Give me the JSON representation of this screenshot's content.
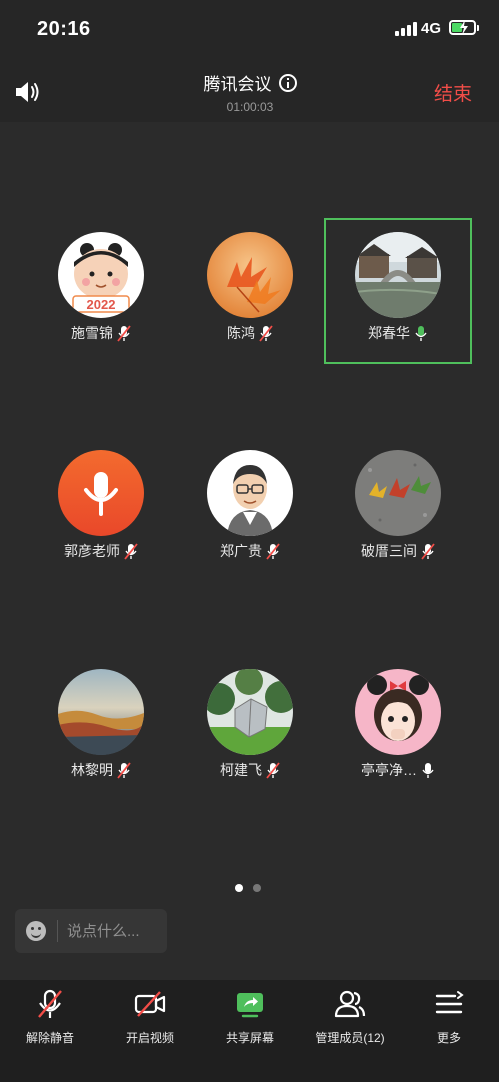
{
  "status_bar": {
    "time": "20:16",
    "network": "4G"
  },
  "header": {
    "title": "腾讯会议",
    "timer": "01:00:03",
    "end_label": "结束"
  },
  "participants": [
    {
      "name": "施雪锦",
      "mic": "muted",
      "avatar": "cartoon-girl-2022"
    },
    {
      "name": "陈鸿",
      "mic": "muted",
      "avatar": "maple-leaves"
    },
    {
      "name": "郑春华",
      "mic": "speaking",
      "avatar": "water-town-bridge"
    },
    {
      "name": "郭彦老师",
      "mic": "muted",
      "avatar": "orange-mic"
    },
    {
      "name": "郑广贵",
      "mic": "muted",
      "avatar": "cartoon-man-glasses"
    },
    {
      "name": "破厝三间",
      "mic": "muted",
      "avatar": "leaves-on-ground"
    },
    {
      "name": "林黎明",
      "mic": "muted",
      "avatar": "autumn-landscape"
    },
    {
      "name": "柯建飞",
      "mic": "muted",
      "avatar": "garden-sculpture"
    },
    {
      "name": "亭亭净…",
      "mic": "on",
      "avatar": "cartoon-girl-bow"
    }
  ],
  "pagination": {
    "total": 2,
    "current": 1
  },
  "chat": {
    "placeholder": "说点什么..."
  },
  "toolbar": {
    "unmute": "解除静音",
    "video": "开启视频",
    "share": "共享屏幕",
    "members": "管理成员(12)",
    "more": "更多"
  },
  "colors": {
    "accent_green": "#4fbf5c",
    "end_red": "#f24d48",
    "background": "#2b2b2b"
  }
}
